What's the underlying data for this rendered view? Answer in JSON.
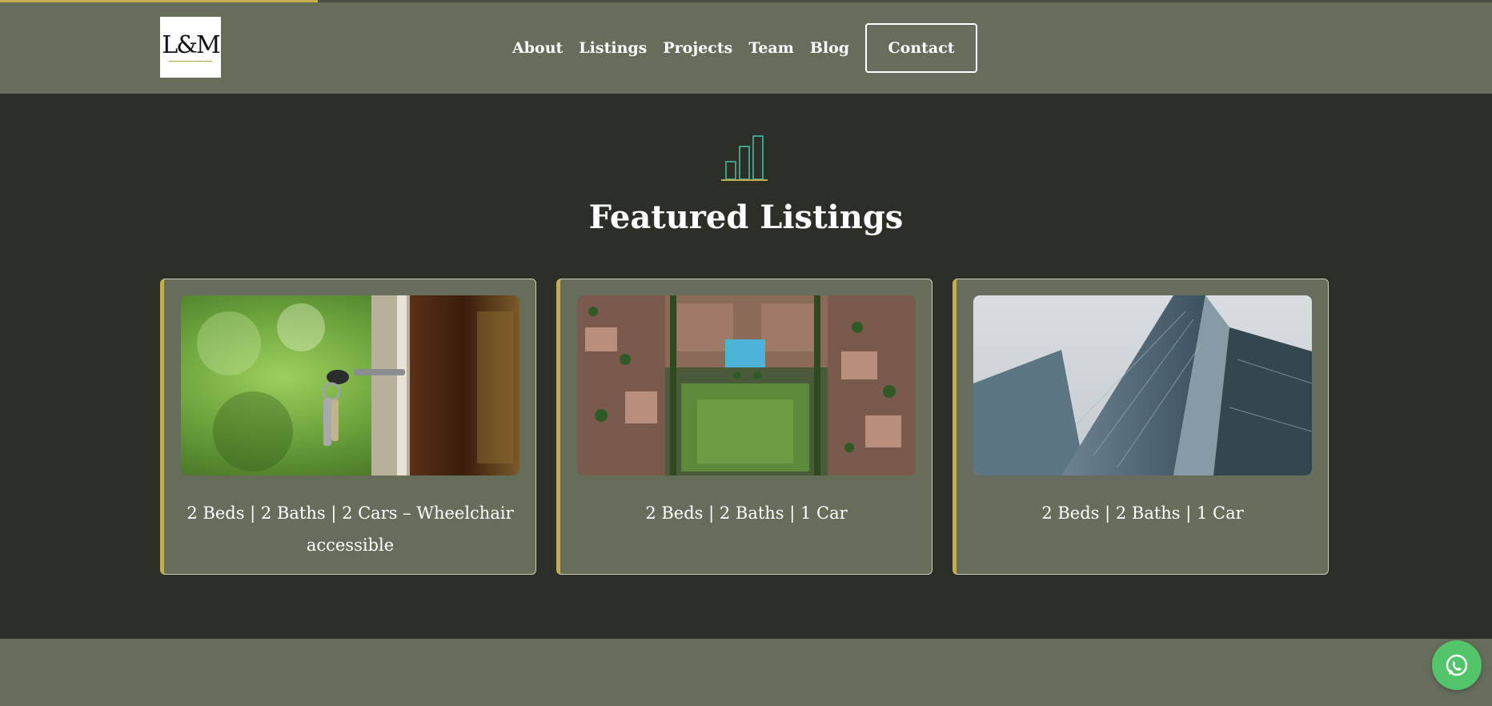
{
  "scroll_progress": 0.213,
  "brand": {
    "logo_text": "L&M"
  },
  "nav": {
    "items": [
      {
        "label": "About"
      },
      {
        "label": "Listings"
      },
      {
        "label": "Projects"
      },
      {
        "label": "Team"
      },
      {
        "label": "Blog"
      }
    ],
    "contact_label": "Contact"
  },
  "featured": {
    "title": "Featured Listings",
    "icon": "bar-chart-icon",
    "listings": [
      {
        "description": "2 Beds | 2 Baths | 2 Cars – Wheelchair accessible",
        "image": "key-in-door-photo"
      },
      {
        "description": "2 Beds | 2 Baths | 1 Car",
        "image": "aerial-estate-photo"
      },
      {
        "description": "2 Beds | 2 Baths | 1 Car",
        "image": "glass-towers-photo"
      }
    ]
  },
  "chat_button": {
    "icon": "whatsapp-icon"
  },
  "colors": {
    "header_bg": "#666d5b",
    "page_bg": "#2c2f28",
    "accent_gold": "#c4ad4e",
    "icon_teal": "#3ea08a",
    "whatsapp_green": "#52c46a"
  }
}
